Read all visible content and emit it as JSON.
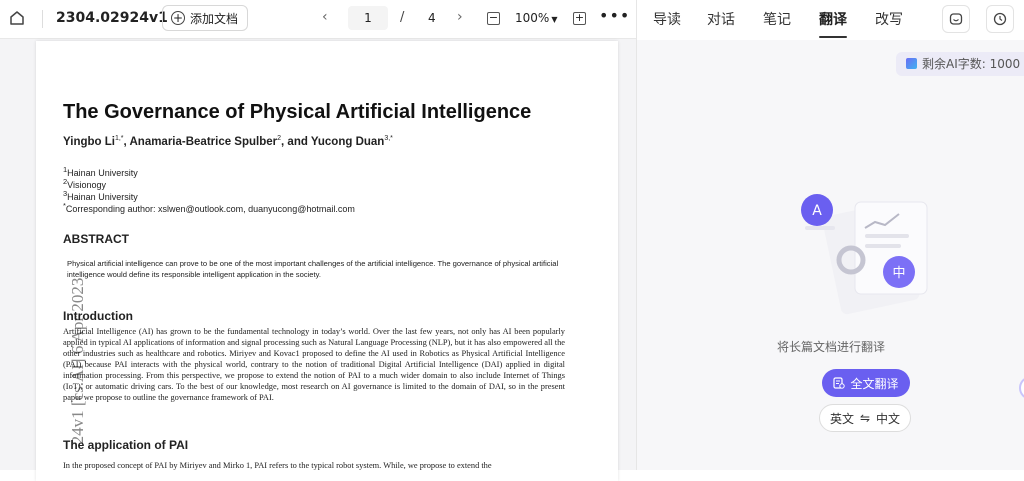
{
  "toolbar": {
    "title": "2304.02924v1",
    "add_doc": "添加文档",
    "page_current": "1",
    "page_sep": "/",
    "page_total": "4",
    "zoom": "100%"
  },
  "paper": {
    "title": "The Governance of Physical Artificial Intelligence",
    "authors": [
      "Yingbo Li",
      "Anamaria-Beatrice Spulber",
      "and Yucong Duan"
    ],
    "author_sups": [
      "1,*",
      "2",
      "3,*"
    ],
    "affiliations": [
      {
        "sup": "1",
        "text": "Hainan University"
      },
      {
        "sup": "2",
        "text": "Visionogy"
      },
      {
        "sup": "3",
        "text": "Hainan University"
      },
      {
        "sup": "*",
        "text": "Corresponding author: xslwen@outlook.com, duanyucong@hotmail.com"
      }
    ],
    "abstract_heading": "ABSTRACT",
    "abstract_text": "Physical artificial intelligence can prove to be one of the most important challenges of the artificial intelligence. The governance of physical artificial intelligence would define its responsible intelligent application in the society.",
    "intro_heading": "Introduction",
    "intro_text": "Artificial Intelligence (AI) has grown to be the fundamental technology in today’s world. Over the last few years, not only has AI been popularly applied in typical AI applications of information and signal processing such as Natural Language Processing (NLP), but it has also empowered all the other industries such as healthcare and robotics. Miriyev and Kovac1 proposed to define the AI used in Robotics as Physical Artificial Intelligence (PAI) because PAI interacts with the physical world, contrary to the notion of traditional Digital Artificial Intelligence (DAI) applied in digital information processing. From this perspective, we propose to extend the notion of PAI to a much wider domain to also include Internet of Things (IoT), or automatic driving cars. To the best of our knowledge, most research on AI governance is limited to the domain of DAI, so in the present paper we propose to outline the governance framework of PAI.",
    "pai_heading": "The application of PAI",
    "pai_text": "In the proposed concept of PAI by Miriyev and Mirko 1, PAI refers to the typical robot system. While, we propose to extend the",
    "side_stamp": "24v1  [cs.AI]  6 Apr 2023"
  },
  "panel": {
    "tabs": [
      "导读",
      "对话",
      "笔记",
      "翻译",
      "改写"
    ],
    "active_tab": "翻译",
    "quota_label": "剩余AI字数:",
    "quota_value": "1000",
    "bubble_a": "A",
    "bubble_zh": "中",
    "hint": "将长篇文档进行翻译",
    "full_translate": "全文翻译",
    "lang_from": "英文",
    "lang_swap": "⇋",
    "lang_to": "中文"
  },
  "colors": {
    "accent": "#6a5ff0",
    "quota_bg": "#ecebf7"
  }
}
